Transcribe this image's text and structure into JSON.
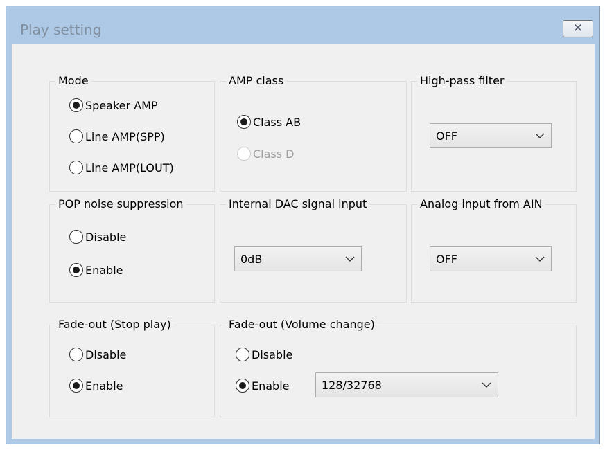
{
  "window": {
    "title": "Play setting",
    "close_label": "✕"
  },
  "mode": {
    "title": "Mode",
    "options": [
      {
        "label": "Speaker AMP",
        "checked": true
      },
      {
        "label": "Line AMP(SPP)",
        "checked": false
      },
      {
        "label": "Line AMP(LOUT)",
        "checked": false
      }
    ]
  },
  "amp_class": {
    "title": "AMP class",
    "options": [
      {
        "label": "Class AB",
        "checked": true
      },
      {
        "label": "Class D",
        "checked": false,
        "disabled": true
      }
    ]
  },
  "high_pass": {
    "title": "High-pass filter",
    "value": "OFF"
  },
  "pop_noise": {
    "title": "POP noise suppression",
    "options": [
      {
        "label": "Disable",
        "checked": false
      },
      {
        "label": "Enable",
        "checked": true
      }
    ]
  },
  "internal_dac": {
    "title": "Internal DAC signal input",
    "value": "0dB"
  },
  "analog_ain": {
    "title": "Analog input from AIN",
    "value": "OFF"
  },
  "fade_stop": {
    "title": "Fade-out (Stop play)",
    "options": [
      {
        "label": "Disable",
        "checked": false
      },
      {
        "label": "Enable",
        "checked": true
      }
    ]
  },
  "fade_volume": {
    "title": "Fade-out (Volume change)",
    "options": [
      {
        "label": "Disable",
        "checked": false
      },
      {
        "label": "Enable",
        "checked": true
      }
    ],
    "value": "128/32768"
  }
}
